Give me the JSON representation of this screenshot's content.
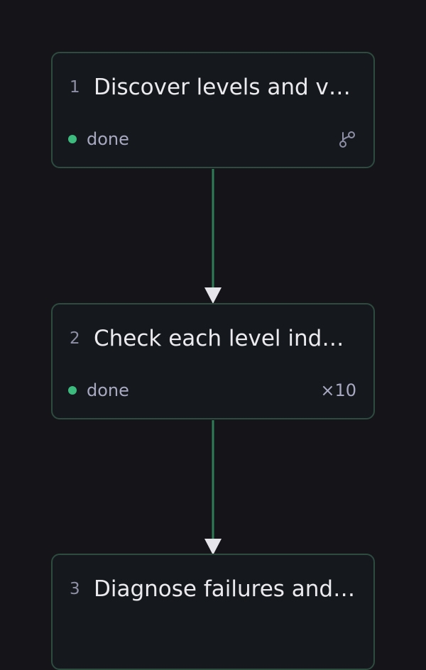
{
  "nodes": [
    {
      "index": "1",
      "title": "Discover levels and v…",
      "status": "done",
      "meta_icon": "branch-icon",
      "meta_text": ""
    },
    {
      "index": "2",
      "title": "Check each level ind…",
      "status": "done",
      "meta_icon": "",
      "meta_text": "×10"
    },
    {
      "index": "3",
      "title": "Diagnose failures and…",
      "status": "",
      "meta_icon": "",
      "meta_text": ""
    }
  ],
  "colors": {
    "background": "#151519",
    "node_fill": "#15191d",
    "node_border": "#2e4b3f",
    "edge": "#2f7a57",
    "arrowhead": "#e6e6ea",
    "status_done": "#3dbb7f"
  }
}
